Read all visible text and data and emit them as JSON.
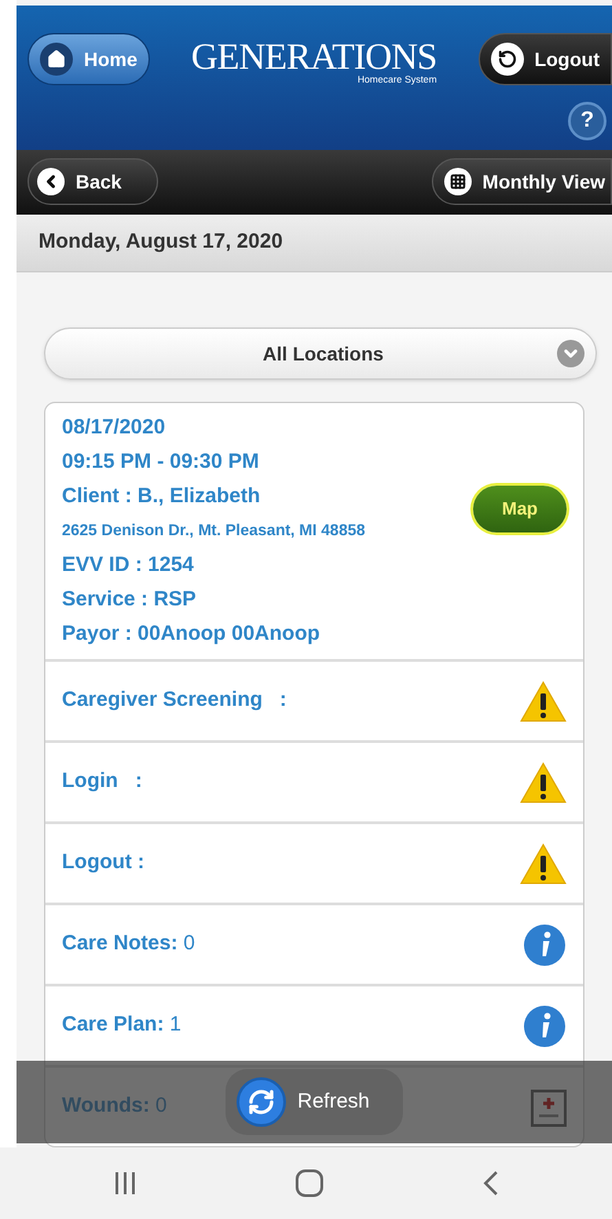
{
  "header": {
    "home": "Home",
    "logo": "GENERATIONS",
    "logo_subtitle": "Homecare System",
    "logout": "Logout",
    "help": "?"
  },
  "toolbar": {
    "back": "Back",
    "monthly_view": "Monthly View"
  },
  "date_heading": "Monday, August 17, 2020",
  "location_select": {
    "value": "All Locations"
  },
  "visit": {
    "date": "08/17/2020",
    "time": "09:15 PM - 09:30 PM",
    "client": "Client : B., Elizabeth",
    "address": "2625 Denison Dr., Mt. Pleasant, MI 48858",
    "evv": "EVV ID : 1254",
    "service": "Service : RSP",
    "payor": "Payor : 00Anoop 00Anoop",
    "map": "Map"
  },
  "rows": [
    {
      "kind": "warning",
      "label": "Caregiver Screening   :"
    },
    {
      "kind": "warning",
      "label": "Login   :"
    },
    {
      "kind": "warning",
      "label": "Logout :"
    },
    {
      "kind": "info",
      "label": "Care Notes:",
      "value": "0"
    },
    {
      "kind": "info",
      "label": "Care Plan:",
      "value": "1"
    },
    {
      "kind": "medical",
      "label": "Wounds:",
      "value": "0"
    }
  ],
  "refresh": "Refresh"
}
